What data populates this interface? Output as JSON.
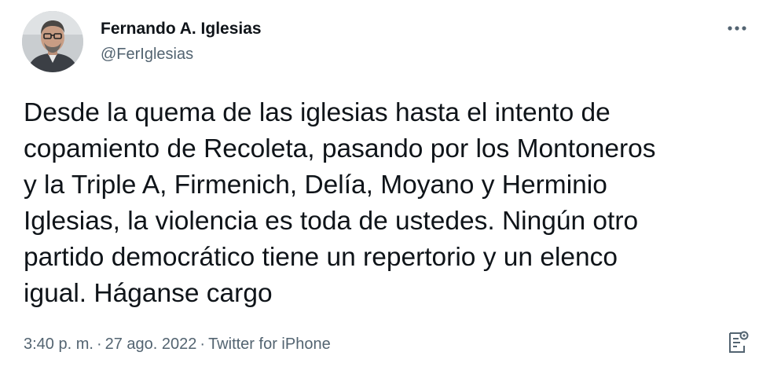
{
  "author": {
    "display_name": "Fernando A. Iglesias",
    "handle": "@FerIglesias",
    "avatar_icon": "profile-photo"
  },
  "tweet": {
    "text": "Desde la quema de las iglesias hasta el intento de\ncopamiento de Recoleta, pasando por los Montoneros\ny la Triple A, Firmenich, Delía, Moyano y Herminio\nIglesias, la violencia es toda de ustedes. Ningún otro\npartido democrático tiene un repertorio y un elenco\nigual. Háganse cargo"
  },
  "meta": {
    "time": "3:40 p. m.",
    "separator": "·",
    "date": "27 ago. 2022",
    "client": "Twitter for iPhone"
  },
  "icons": {
    "more": "more-horizontal-icon",
    "analytics": "analytics-icon"
  },
  "colors": {
    "text_primary": "#0f1419",
    "text_secondary": "#536471",
    "background": "#ffffff"
  }
}
